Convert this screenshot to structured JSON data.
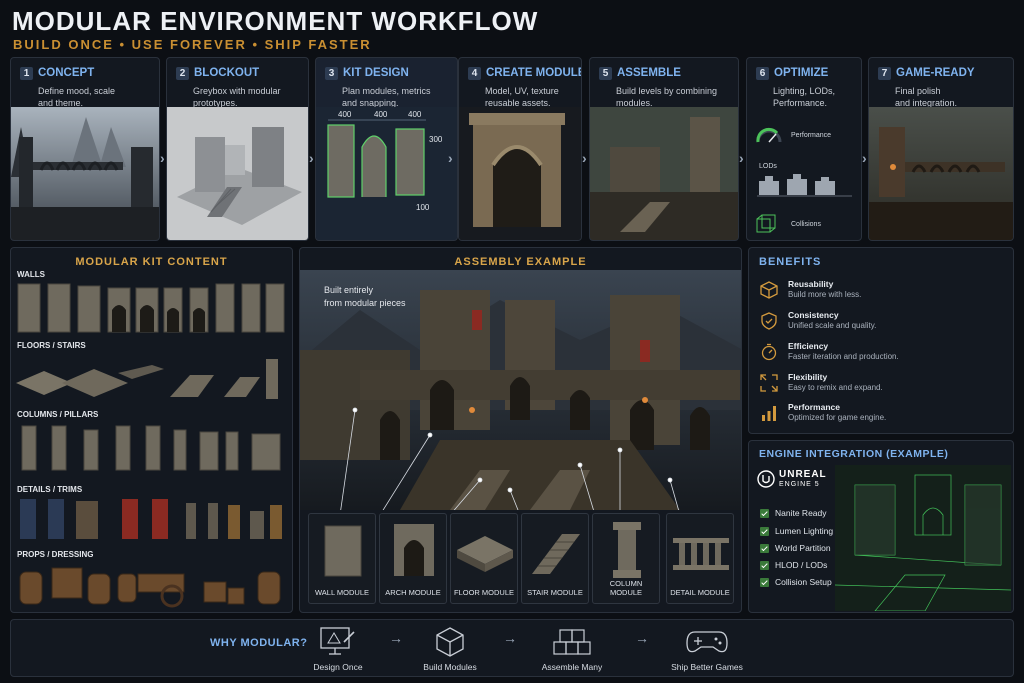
{
  "header": {
    "title": "MODULAR ENVIRONMENT WORKFLOW",
    "subtitle": "BUILD ONCE • USE FOREVER • SHIP FASTER"
  },
  "steps": [
    {
      "num": "1",
      "title": "CONCEPT",
      "desc": "Define mood, scale\nand theme."
    },
    {
      "num": "2",
      "title": "BLOCKOUT",
      "desc": "Greybox with modular\nprototypes."
    },
    {
      "num": "3",
      "title": "KIT DESIGN",
      "desc": "Plan modules, metrics\nand snapping."
    },
    {
      "num": "4",
      "title": "CREATE MODULES",
      "desc": "Model, UV, texture\nreusable assets."
    },
    {
      "num": "5",
      "title": "ASSEMBLE",
      "desc": "Build levels by combining\nmodules."
    },
    {
      "num": "6",
      "title": "OPTIMIZE",
      "desc": "Lighting, LODs,\nPerformance."
    },
    {
      "num": "7",
      "title": "GAME-READY",
      "desc": "Final polish\nand integration."
    }
  ],
  "kit_design": {
    "dim1": "400",
    "dim2": "400",
    "dim3": "400",
    "dim_height": "300",
    "dim_depth": "100"
  },
  "optimize": {
    "performance": "Performance",
    "lods": "LODs",
    "collisions": "Collisions",
    "gauge_level": 0.7
  },
  "kit": {
    "title": "MODULAR KIT CONTENT",
    "categories": [
      "WALLS",
      "FLOORS / STAIRS",
      "COLUMNS / PILLARS",
      "DETAILS / TRIMS",
      "PROPS / DRESSING"
    ]
  },
  "assembly": {
    "title": "ASSEMBLY EXAMPLE",
    "note": "Built entirely\nfrom modular pieces",
    "modules": [
      "WALL MODULE",
      "ARCH MODULE",
      "FLOOR MODULE",
      "STAIR MODULE",
      "COLUMN MODULE",
      "DETAIL MODULE"
    ]
  },
  "benefits": {
    "title": "BENEFITS",
    "items": [
      {
        "title": "Reusability",
        "desc": "Build more with less.",
        "icon": "box-icon"
      },
      {
        "title": "Consistency",
        "desc": "Unified scale and quality.",
        "icon": "shield-icon"
      },
      {
        "title": "Efficiency",
        "desc": "Faster iteration and production.",
        "icon": "stopwatch-icon"
      },
      {
        "title": "Flexibility",
        "desc": "Easy to remix and expand.",
        "icon": "expand-arrows-icon"
      },
      {
        "title": "Performance",
        "desc": "Optimized for game engine.",
        "icon": "bar-chart-icon"
      }
    ]
  },
  "engine": {
    "title": "ENGINE INTEGRATION (EXAMPLE)",
    "logo_line1": "UNREAL",
    "logo_line2": "ENGINE 5",
    "features": [
      "Nanite Ready",
      "Lumen Lighting",
      "World Partition",
      "HLOD / LODs",
      "Collision Setup"
    ]
  },
  "why": {
    "label": "WHY MODULAR?",
    "items": [
      "Design Once",
      "Build Modules",
      "Assemble Many",
      "Ship Better Games"
    ]
  },
  "colors": {
    "accent_gold": "#c98f32",
    "accent_blue": "#7fb3ef",
    "check_green": "#3a7a3a"
  }
}
